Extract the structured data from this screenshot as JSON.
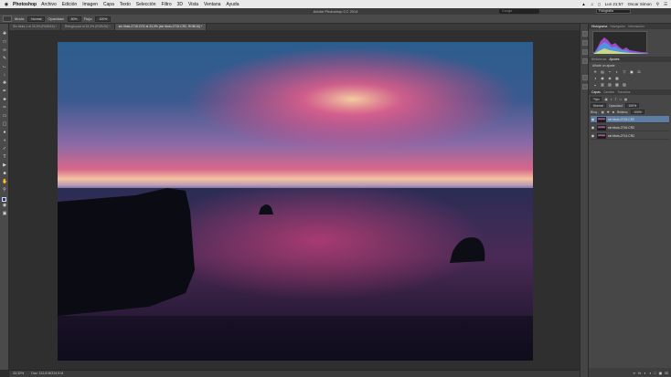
{
  "menubar": {
    "apple": "",
    "app_name": "Photoshop",
    "items": [
      "Archivo",
      "Edición",
      "Imagen",
      "Capa",
      "Texto",
      "Selección",
      "Filtro",
      "3D",
      "Vista",
      "Ventana",
      "Ayuda"
    ],
    "clock": "Lun 21:57",
    "user": "Oscar Simon"
  },
  "app": {
    "title": "Adobe Photoshop CC 2014",
    "search_placeholder": "Google",
    "workspace": "Fotografía"
  },
  "options_bar": {
    "mode_label": "Modo:",
    "mode_value": "Normal",
    "opacity_label": "Opacidad:",
    "opacity_value": "80%",
    "flow_label": "Flujo:",
    "flow_value": "100%"
  },
  "doc_tabs": [
    "Sin título-1 al 33,3% (RGB/16) *",
    "Refugio.psd al 33,3% (RGB/16) *",
    "sin título-2715.CR2 al 33,3% (sin título-2715.CR2, RGB/16) *"
  ],
  "status": {
    "zoom": "33,33%",
    "doc_size": "Doc: 112,8 M/319,5 M"
  },
  "panels": {
    "top_tabs": [
      "Histograma",
      "Navegador",
      "Información"
    ],
    "adj_tabs": [
      "Bibliotecas",
      "Ajustes"
    ],
    "adj_title": "Añadir un ajuste",
    "layer_tabs": [
      "Capas",
      "Canales",
      "Trazados"
    ],
    "kind_filter": "Tipo",
    "blend_mode": "Normal",
    "opacity_label": "Opacidad:",
    "opacity_value": "100%",
    "lock_label": "Bloq.:",
    "fill_label": "Relleno:",
    "fill_value": "100%",
    "layers": [
      {
        "name": "sin título-2715.CR2",
        "selected": true
      },
      {
        "name": "sin título-2716.CR2",
        "selected": false
      },
      {
        "name": "sin título-2714.CR2",
        "selected": false
      }
    ]
  },
  "colors": {
    "ui_dark": "#2b2b2b",
    "panel": "#474747",
    "selection": "#5d7da2"
  }
}
